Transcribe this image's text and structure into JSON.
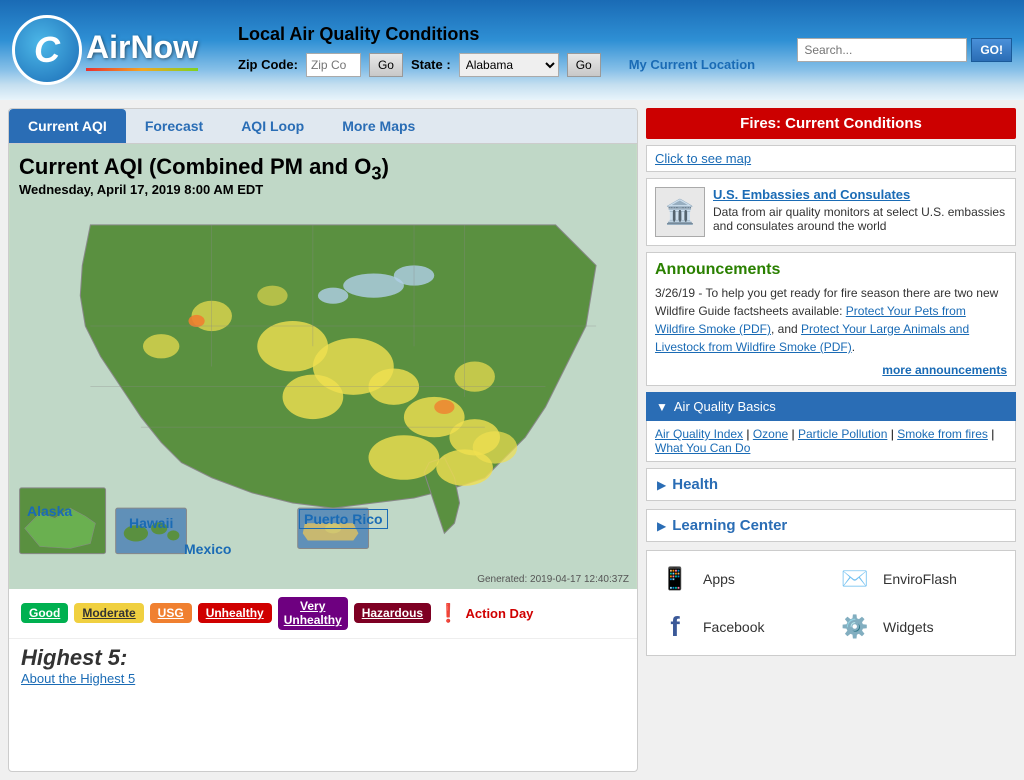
{
  "header": {
    "logo_text": "AirNow",
    "title": "Local Air Quality Conditions",
    "zip_label": "Zip Code:",
    "zip_placeholder": "Zip Co",
    "go_label": "Go",
    "state_label": "State :",
    "state_value": "Alabama",
    "state_go_label": "Go",
    "my_location_label": "My Current Location",
    "search_placeholder": "Search...",
    "search_go_label": "GO!"
  },
  "tabs": [
    {
      "label": "Current AQI",
      "active": true
    },
    {
      "label": "Forecast",
      "active": false
    },
    {
      "label": "AQI Loop",
      "active": false
    },
    {
      "label": "More Maps",
      "active": false
    }
  ],
  "map": {
    "title": "Current AQI (Combined PM and O",
    "title_sub": "3",
    "subtitle": "Wednesday, April 17, 2019 8:00 AM EDT",
    "generated": "Generated: 2019-04-17 12:40:37Z",
    "alaska_label": "Alaska",
    "hawaii_label": "Hawaii",
    "mexico_label": "Mexico",
    "puerto_rico_label": "Puerto Rico"
  },
  "legend": {
    "items": [
      {
        "label": "Good",
        "class": "badge-good"
      },
      {
        "label": "Moderate",
        "class": "badge-moderate"
      },
      {
        "label": "USG",
        "class": "badge-usg"
      },
      {
        "label": "Unhealthy",
        "class": "badge-unhealthy"
      },
      {
        "label": "Very\nUnhealthy",
        "class": "badge-very-unhealthy"
      },
      {
        "label": "Hazardous",
        "class": "badge-hazardous"
      }
    ],
    "action_day_label": "Action Day"
  },
  "highest": {
    "title": "Highest 5:",
    "about_link": "About the Highest 5"
  },
  "right_panel": {
    "fires_title": "Fires: Current Conditions",
    "fires_link": "Click to see map",
    "embassy_link": "U.S. Embassies and Consulates",
    "embassy_desc": "Data from air quality monitors at select U.S. embassies and consulates around the world",
    "announcements_title": "Announcements",
    "announcements_text": "3/26/19 - To help you get ready for fire season there are two new Wildfire Guide factsheets available: ",
    "announce_link1": "Protect Your Pets from Wildfire Smoke (PDF)",
    "announce_link2": "Protect Your Large Animals and Livestock from Wildfire Smoke (PDF)",
    "more_announcements": "more announcements",
    "aq_basics_title": "Air Quality Basics",
    "aq_basics_links": [
      "Air Quality Index",
      "Ozone",
      "Particle Pollution",
      "Smoke from fires",
      "What You Can Do"
    ],
    "health_label": "Health",
    "learning_center_label": "Learning Center",
    "apps_label": "Apps",
    "enviroflash_label": "EnviroFlash",
    "facebook_label": "Facebook",
    "widgets_label": "Widgets"
  }
}
